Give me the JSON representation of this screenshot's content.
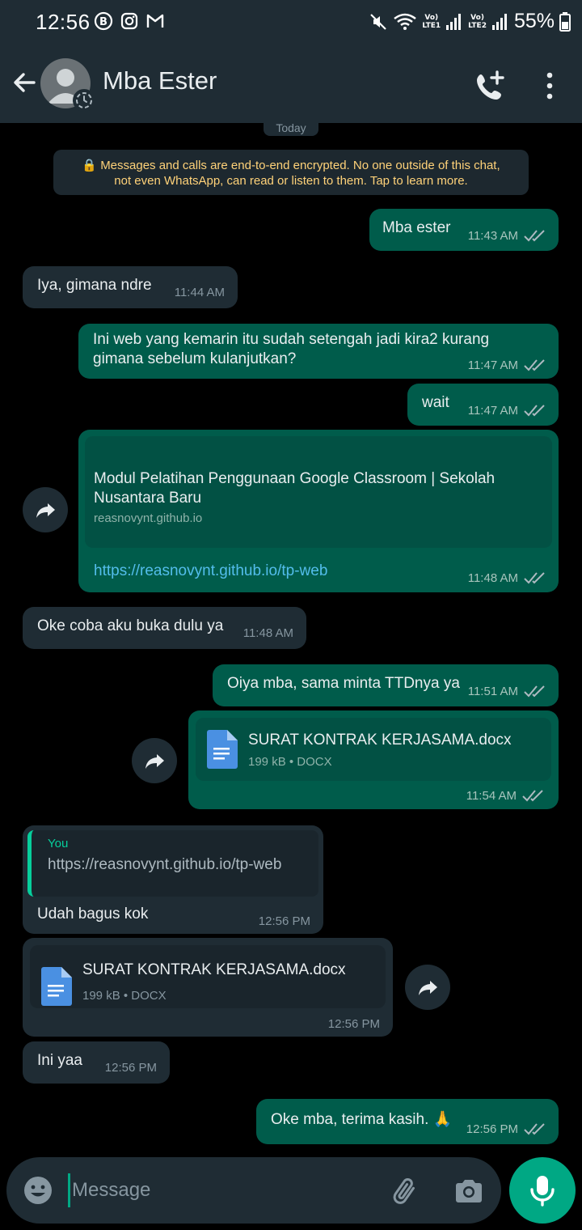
{
  "status_bar": {
    "time": "12:56",
    "battery": "55%",
    "sim1_label": "Vo) LTE1",
    "sim2_label": "Vo) LTE2",
    "icons": [
      "bbm-icon",
      "instagram-icon",
      "gmail-icon",
      "mute-icon",
      "wifi-icon",
      "signal-icon",
      "battery-icon"
    ]
  },
  "header": {
    "contact_name": "Mba Ester",
    "icons": [
      "back-arrow-icon",
      "avatar",
      "call-add-icon",
      "more-vert-icon"
    ]
  },
  "chat": {
    "date_chip": "Today",
    "encryption_notice": "🔒 Messages and calls are end-to-end encrypted. No one outside of this chat, not even WhatsApp, can read or listen to them. Tap to learn more.",
    "messages": [
      {
        "dir": "out",
        "text": "Mba ester",
        "time": "11:43 AM"
      },
      {
        "dir": "in",
        "text": "Iya, gimana ndre",
        "time": "11:44 AM"
      },
      {
        "dir": "out",
        "text_line1": "Ini web yang kemarin itu sudah setengah jadi kira2 kurang",
        "text_line2": "gimana sebelum kulanjutkan?",
        "time": "11:47 AM"
      },
      {
        "dir": "out",
        "text": "wait",
        "time": "11:47 AM"
      },
      {
        "dir": "out",
        "link_title": "Modul Pelatihan Penggunaan Google Classroom | Sekolah Nusantara Baru",
        "link_domain": "reasnovynt.github.io",
        "link_url": "https://reasnovynt.github.io/tp-web",
        "time": "11:48 AM"
      },
      {
        "dir": "in",
        "text": "Oke coba aku buka dulu ya",
        "time": "11:48 AM"
      },
      {
        "dir": "out",
        "text": "Oiya mba, sama minta TTDnya ya",
        "time": "11:51 AM"
      },
      {
        "dir": "out",
        "doc_name": "SURAT KONTRAK KERJASAMA.docx",
        "doc_meta": "199 kB • DOCX",
        "time": "11:54 AM"
      },
      {
        "dir": "in",
        "quote_author": "You",
        "quote_text": "https://reasnovynt.github.io/tp-web",
        "text": "Udah bagus kok",
        "time": "12:56 PM"
      },
      {
        "dir": "in",
        "doc_name": "SURAT KONTRAK KERJASAMA.docx",
        "doc_meta": "199 kB • DOCX",
        "time": "12:56 PM"
      },
      {
        "dir": "in",
        "text": "Ini yaa",
        "time": "12:56 PM"
      },
      {
        "dir": "out",
        "text": "Oke mba, terima kasih. 🙏",
        "time": "12:56 PM"
      }
    ]
  },
  "composer": {
    "placeholder": "Message",
    "icons": [
      "emoji-icon",
      "attach-icon",
      "camera-icon",
      "mic-icon"
    ]
  },
  "colors": {
    "header_bg": "#1f2c34",
    "outgoing_bubble": "#005c4b",
    "incoming_bubble": "#1f2c34",
    "accent": "#00a884",
    "link": "#53bdeb",
    "notice_text": "#ffd279"
  }
}
